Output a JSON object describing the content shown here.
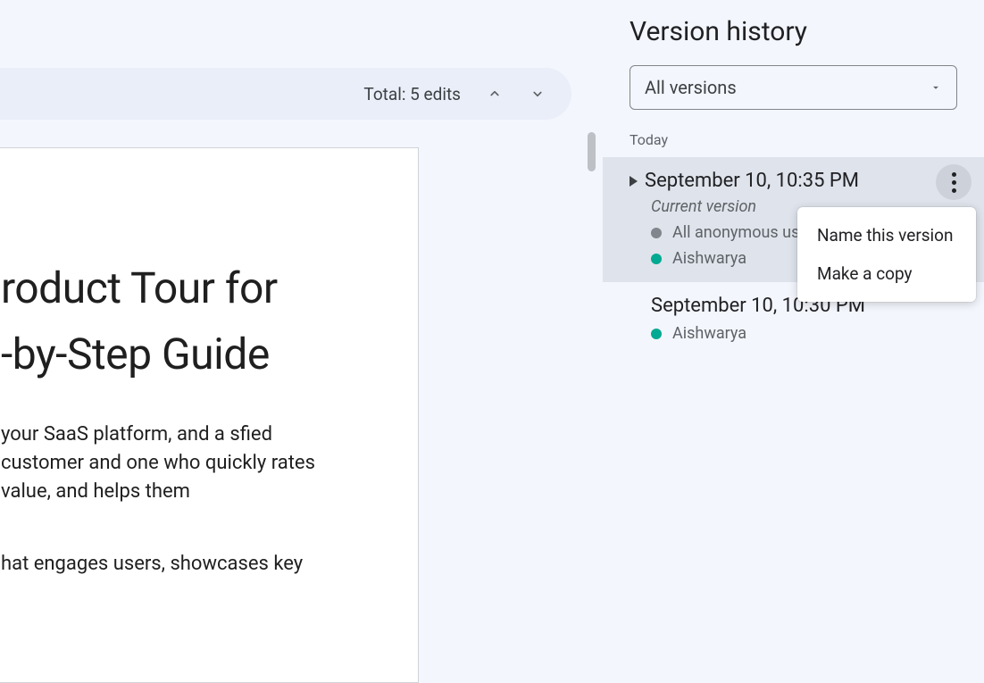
{
  "editsBar": {
    "label": "Total: 5 edits"
  },
  "document": {
    "titleLine1": "roduct Tour for",
    "titleLine2": "-by-Step Guide",
    "para1": " your SaaS platform, and a sfied customer and one who quickly rates value, and helps them",
    "para2": "hat engages users, showcases key"
  },
  "sidebar": {
    "title": "Version history",
    "filter": {
      "selected": "All versions"
    },
    "sectionLabel": "Today"
  },
  "versions": [
    {
      "timestamp": "September 10, 10:35 PM",
      "subtitle": "Current version",
      "collaborators": [
        {
          "name": "All anonymous users",
          "color": "#80868b"
        },
        {
          "name": "Aishwarya",
          "color": "#00a991"
        }
      ]
    },
    {
      "timestamp": "September 10, 10:30 PM",
      "collaborators": [
        {
          "name": "Aishwarya",
          "color": "#00a991"
        }
      ]
    }
  ],
  "contextMenu": {
    "items": [
      "Name this version",
      "Make a copy"
    ]
  }
}
